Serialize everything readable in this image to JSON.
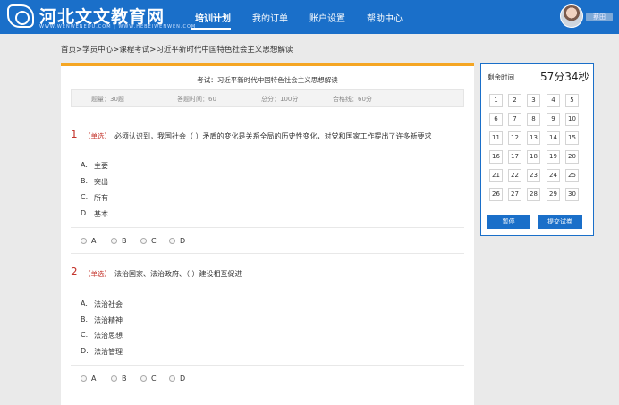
{
  "header": {
    "logo_text": "河北文文教育网",
    "logo_sub": "WWW.WENWENEDU.COM | WWW.HEBEIWENWEN.COM",
    "nav": [
      "培训计划",
      "我的订单",
      "账户设置",
      "帮助中心"
    ],
    "username": "蔡田"
  },
  "breadcrumb": "首页>学员中心>课程考试>习近平新时代中国特色社会主义思想解读",
  "exam": {
    "title": "考试：习近平新时代中国特色社会主义思想解读",
    "info": [
      "题量：30题",
      "答题时间：60",
      "总分：100分",
      "合格线：60分"
    ]
  },
  "questions": [
    {
      "number": "1",
      "type": "【单选】",
      "text": "必须认识到，我国社会（ ）矛盾的变化是关系全局的历史性变化，对党和国家工作提出了许多新要求",
      "options": [
        {
          "letter": "A.",
          "text": "主要"
        },
        {
          "letter": "B.",
          "text": "突出"
        },
        {
          "letter": "C.",
          "text": "所有"
        },
        {
          "letter": "D.",
          "text": "基本"
        }
      ],
      "choices": [
        "A",
        "B",
        "C",
        "D"
      ]
    },
    {
      "number": "2",
      "type": "【单选】",
      "text": "法治国家、法治政府、（ ）建设相互促进",
      "options": [
        {
          "letter": "A.",
          "text": "法治社会"
        },
        {
          "letter": "B.",
          "text": "法治精神"
        },
        {
          "letter": "C.",
          "text": "法治思想"
        },
        {
          "letter": "D.",
          "text": "法治管理"
        }
      ],
      "choices": [
        "A",
        "B",
        "C",
        "D"
      ]
    }
  ],
  "panel": {
    "label": "剩余时间",
    "timer": "57分34秒",
    "numbers": [
      "1",
      "2",
      "3",
      "4",
      "5",
      "6",
      "7",
      "8",
      "9",
      "10",
      "11",
      "12",
      "13",
      "14",
      "15",
      "16",
      "17",
      "18",
      "19",
      "20",
      "21",
      "22",
      "23",
      "24",
      "25",
      "26",
      "27",
      "28",
      "29",
      "30"
    ],
    "pause_label": "暂停",
    "submit_label": "提交试卷"
  }
}
